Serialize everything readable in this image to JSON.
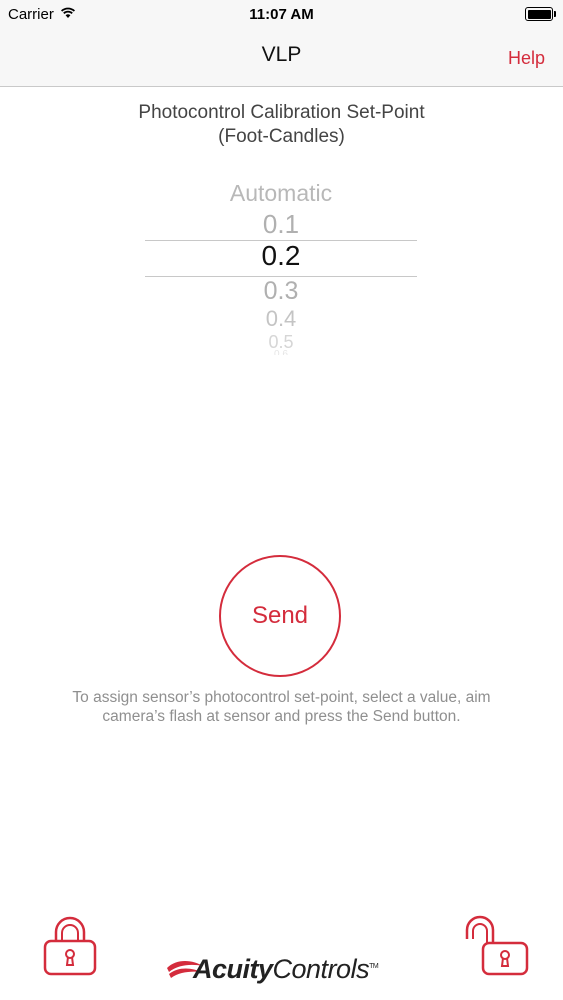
{
  "status_bar": {
    "carrier": "Carrier",
    "time": "11:07 AM"
  },
  "nav": {
    "title": "VLP",
    "help_label": "Help"
  },
  "heading": {
    "line1": "Photocontrol Calibration Set-Point",
    "line2": "(Foot-Candles)"
  },
  "picker": {
    "options": [
      "Automatic",
      "0.1",
      "0.2",
      "0.3",
      "0.4",
      "0.5",
      "0.6"
    ],
    "selected": "0.2"
  },
  "send_label": "Send",
  "instructions": "To assign sensor’s photocontrol set-point, select a value, aim camera’s flash at sensor and press the Send button.",
  "footer": {
    "logo_bold": "Acuity",
    "logo_light": "Controls",
    "logo_tm": "TM",
    "left_icon": "lock-closed-icon",
    "right_icon": "lock-open-icon"
  },
  "colors": {
    "accent": "#d42c3c",
    "nav_bg": "#f7f7f7",
    "muted_text": "#8f8f8f"
  }
}
